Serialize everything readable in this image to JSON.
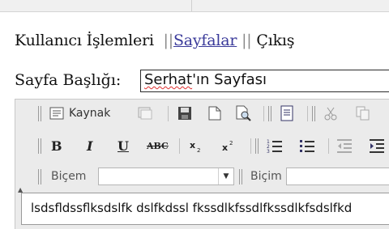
{
  "nav": {
    "user_ops": "Kullanıcı İşlemleri",
    "sep1": "||",
    "pages": "Sayfalar",
    "sep2": "||",
    "logout": "Çıkış"
  },
  "form": {
    "title_label": "Sayfa Başlığı:",
    "title_value_misspelled": "Serhat",
    "title_value_rest": "'ın Sayfası"
  },
  "toolbar": {
    "source_label": "Kaynak",
    "format_label": "Biçem",
    "format_value": "",
    "format2_label": "Biçim",
    "format2_value": "",
    "bold": "B",
    "italic": "I",
    "underline": "U",
    "strike": "ABC",
    "collapse": "▲"
  },
  "editor": {
    "content": "lsdsfldssflksdslfk dslfkdssl fkssdlkfssdlfkssdlkfsdslfkd"
  },
  "colors": {
    "link": "#3a3a9a",
    "toolbar_bg": "#ebebeb",
    "spell_error": "#e03030"
  }
}
